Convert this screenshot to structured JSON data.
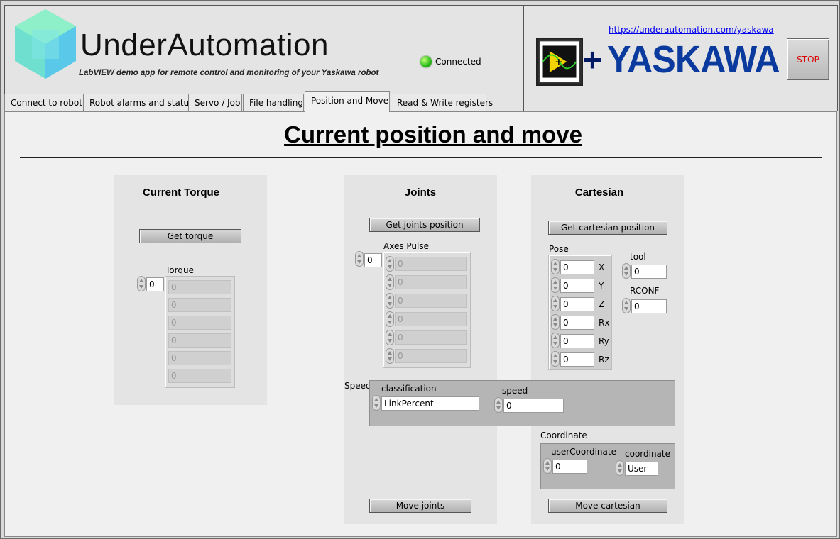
{
  "header": {
    "brand_name": "UnderAutomation",
    "subtitle": "LabVIEW demo app for remote control and monitoring of your Yaskawa robot",
    "status_label": "Connected",
    "url": "https://underautomation.com/yaskawa",
    "plus": "+",
    "yaskawa_logo": "YASKAWA",
    "stop_label": "STOP"
  },
  "tabs": [
    {
      "label": "Connect to robot"
    },
    {
      "label": "Robot alarms and status"
    },
    {
      "label": "Servo / Job"
    },
    {
      "label": "File handling"
    },
    {
      "label": "Position and Move"
    },
    {
      "label": "Read & Write registers"
    }
  ],
  "active_tab": "Position and Move",
  "page_title": "Current position and move",
  "torque": {
    "title": "Current Torque",
    "button": "Get torque",
    "array_label": "Torque",
    "index": "0",
    "values": [
      "0",
      "0",
      "0",
      "0",
      "0",
      "0"
    ]
  },
  "joints": {
    "title": "Joints",
    "button": "Get joints position",
    "array_label": "Axes Pulse",
    "index": "0",
    "values": [
      "0",
      "0",
      "0",
      "0",
      "0",
      "0"
    ],
    "move_button": "Move joints"
  },
  "speed": {
    "label": "Speed",
    "classification_label": "classification",
    "classification_value": "LinkPercent",
    "speed_label": "speed",
    "speed_value": "0"
  },
  "cartesian": {
    "title": "Cartesian",
    "button": "Get cartesian position",
    "pose_label": "Pose",
    "pose": [
      {
        "axis": "X",
        "value": "0"
      },
      {
        "axis": "Y",
        "value": "0"
      },
      {
        "axis": "Z",
        "value": "0"
      },
      {
        "axis": "Rx",
        "value": "0"
      },
      {
        "axis": "Ry",
        "value": "0"
      },
      {
        "axis": "Rz",
        "value": "0"
      }
    ],
    "tool_label": "tool",
    "tool_value": "0",
    "rconf_label": "RCONF",
    "rconf_value": "0",
    "coordinate_label": "Coordinate",
    "user_coordinate_label": "userCoordinate",
    "user_coordinate_value": "0",
    "coordinate_type_label": "coordinate",
    "coordinate_type_value": "User",
    "move_button": "Move cartesian"
  }
}
